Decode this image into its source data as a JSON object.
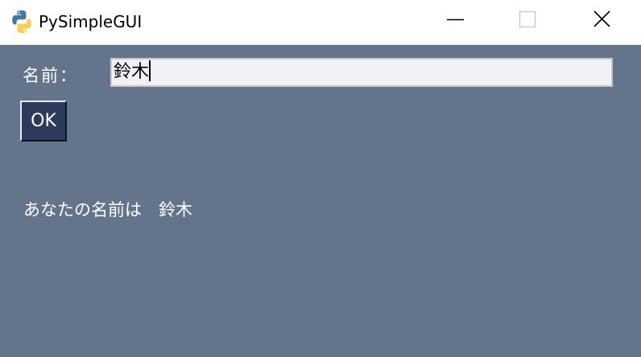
{
  "window": {
    "title": "PySimpleGUI",
    "app_icon": "python-logo-icon",
    "controls": {
      "minimize_icon": "minimize-icon",
      "maximize_icon": "maximize-icon",
      "close_icon": "close-icon"
    }
  },
  "form": {
    "name_label": "名前：",
    "name_input_value": "鈴木",
    "ok_button_label": "OK"
  },
  "output": {
    "result_text": "あなたの名前は　鈴木"
  },
  "colors": {
    "background": "#64758b",
    "button_background": "#2a3b5c",
    "input_background": "#f0f1f5",
    "text": "#ffffff"
  }
}
